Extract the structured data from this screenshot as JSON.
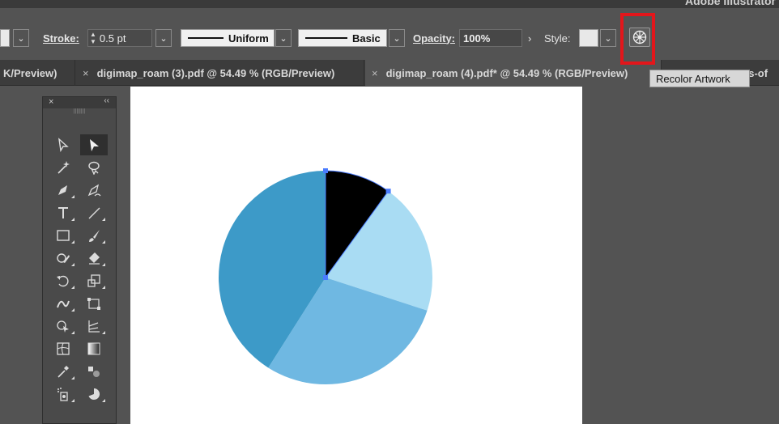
{
  "app": {
    "title": "Adobe Illustrator"
  },
  "control_bar": {
    "stroke_label": "Stroke:",
    "stroke_weight": "0.5 pt",
    "variable_width_profile": "Uniform",
    "brush_definition": "Basic",
    "opacity_label": "Opacity:",
    "opacity_value": "100%",
    "style_label": "Style:",
    "recolor_button_icon": "recolor-wheel-icon"
  },
  "tabs": [
    {
      "label": "K/Preview)",
      "has_close": false
    },
    {
      "label": "digimap_roam (3).pdf @ 54.49 % (RGB/Preview)",
      "has_close": true
    },
    {
      "label": "digimap_roam (4).pdf* @ 54.49 % (RGB/Preview)",
      "has_close": true,
      "active": true
    },
    {
      "label": "es-of",
      "has_close": false
    }
  ],
  "tooltip": {
    "text": "Recolor Artwork"
  },
  "artwork": {
    "pie_slices": [
      {
        "name": "slice-black",
        "percent": 10,
        "color": "#000000"
      },
      {
        "name": "slice-light-blue",
        "percent": 20,
        "color": "#a9dcf3"
      },
      {
        "name": "slice-mid-blue",
        "percent": 29,
        "color": "#6fb8e2"
      },
      {
        "name": "slice-dark-blue",
        "percent": 41,
        "color": "#3d9ac8"
      }
    ],
    "selection_color": "#4a7cff"
  },
  "tools_panel": {
    "close_label": "×",
    "collapse_label": "‹‹",
    "tools": [
      "selection-tool-icon",
      "direct-selection-tool-icon",
      "magic-wand-icon",
      "lasso-icon",
      "pen-tool-icon",
      "curvature-tool-icon",
      "type-tool-icon",
      "line-tool-icon",
      "rectangle-tool-icon",
      "paintbrush-icon",
      "shaper-tool-icon",
      "eraser-icon",
      "rotate-tool-icon",
      "scale-tool-icon",
      "width-tool-icon",
      "free-transform-icon",
      "shape-builder-icon",
      "perspective-grid-icon",
      "mesh-tool-icon",
      "gradient-tool-icon",
      "eyedropper-icon",
      "blend-tool-icon",
      "symbol-sprayer-icon",
      "graph-tool-icon"
    ]
  },
  "colors": {
    "highlight": "#e3161b",
    "ui_background": "#535353"
  }
}
